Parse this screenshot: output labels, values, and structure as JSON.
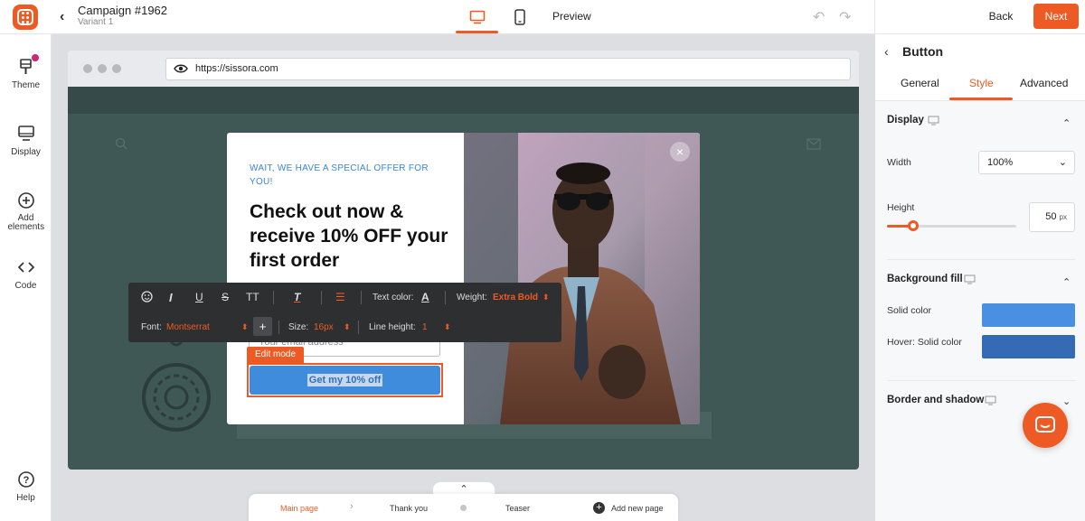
{
  "header": {
    "campaign_title": "Campaign #1962",
    "variant": "Variant 1",
    "preview_label": "Preview",
    "back_label": "Back",
    "next_label": "Next"
  },
  "sidebar": {
    "items": [
      {
        "label": "Theme",
        "icon": "theme-icon"
      },
      {
        "label": "Display",
        "icon": "display-icon"
      },
      {
        "label": "Add elements",
        "icon": "add-elements-icon"
      },
      {
        "label": "Code",
        "icon": "code-icon"
      },
      {
        "label": "Help",
        "icon": "help-icon"
      }
    ]
  },
  "browser": {
    "url": "https://sissora.com"
  },
  "popup": {
    "eyebrow": "WAIT, WE HAVE A SPECIAL OFFER FOR YOU!",
    "headline": "Check out now & receive 10% OFF your first order",
    "email_placeholder": "Your email address",
    "edit_mode_label": "Edit mode",
    "cta_label": "Get my 10% off"
  },
  "text_toolbar": {
    "text_color_label": "Text color:",
    "weight_label": "Weight:",
    "weight_value": "Extra Bold",
    "font_label": "Font:",
    "font_value": "Montserrat",
    "size_label": "Size:",
    "size_value": "16px",
    "line_height_label": "Line height:",
    "line_height_value": "1"
  },
  "page_tabs": {
    "items": [
      "Main page",
      "Thank you",
      "Teaser"
    ],
    "add_label": "Add new page",
    "active": "Main page"
  },
  "right_panel": {
    "title": "Button",
    "tabs": [
      "General",
      "Style",
      "Advanced"
    ],
    "active_tab": "Style",
    "display_section": "Display",
    "width_label": "Width",
    "width_value": "100%",
    "height_label": "Height",
    "height_value": "50",
    "height_unit": "px",
    "height_slider_fraction": 0.2,
    "bg_section": "Background fill",
    "solid_color_label": "Solid color",
    "hover_label": "Hover: Solid color",
    "border_section": "Border and shadow"
  },
  "colors": {
    "accent": "#ee5a24",
    "solid_color": "#4a90e2",
    "hover_color": "#356bb5",
    "cta": "#3f8bdc"
  }
}
